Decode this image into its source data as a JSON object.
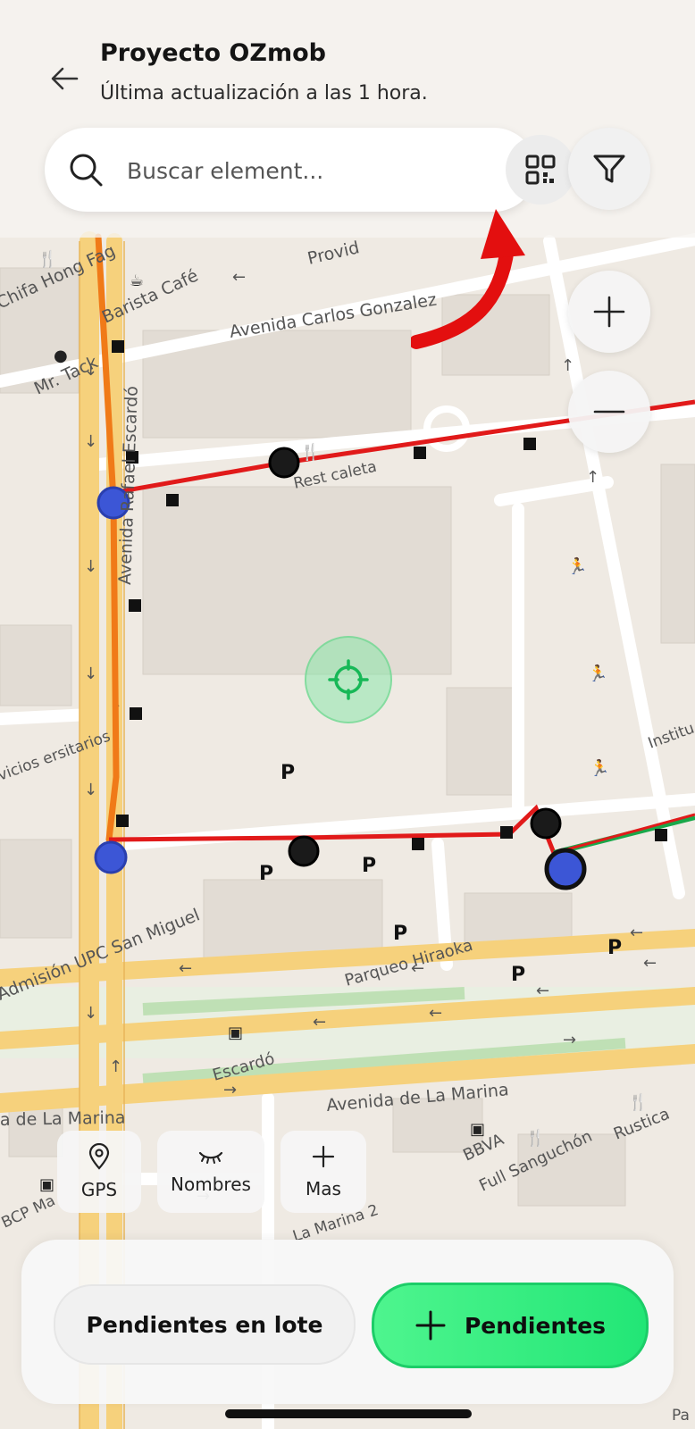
{
  "header": {
    "title": "Proyecto OZmob",
    "subtitle": "Última actualización a las 1 hora."
  },
  "search": {
    "placeholder": "Buscar element..."
  },
  "map": {
    "streets": [
      "Avenida Carlos Gonzalez",
      "Provid",
      "Avenida Rafael Escardó",
      "Rest caleta",
      "Parqueo Hiraoka",
      "Escardó",
      "Avenida de La Marina",
      "a de La Marina",
      "La Marina 2",
      "Avenida de La Marina"
    ],
    "places": [
      "Chifa Hong Fag",
      "Barista Café",
      "Mr. Tack",
      "vicios ersitarios",
      "Admisión UPC San Miguel",
      "Institu Tri",
      "BBVA",
      "Full Sanguchón",
      "Rustica",
      "BCP Ma",
      "Pa"
    ],
    "parking_label": "P"
  },
  "chips": {
    "gps": "GPS",
    "names": "Nombres",
    "more": "Mas"
  },
  "actions": {
    "batch": "Pendientes en lote",
    "pending": "Pendientes"
  },
  "colors": {
    "accent_green": "#22e676",
    "route_red": "#e11a1a",
    "route_orange": "#f07a18",
    "annotation_arrow": "#e30f0f"
  },
  "icons": {
    "back": "arrow-left-icon",
    "search": "search-icon",
    "qr": "qr-code-icon",
    "filter": "filter-icon",
    "zoom_in": "plus-icon",
    "zoom_out": "minus-icon",
    "locate": "crosshair-icon",
    "gps": "map-pin-icon",
    "names": "eye-closed-icon",
    "more": "plus-icon"
  }
}
